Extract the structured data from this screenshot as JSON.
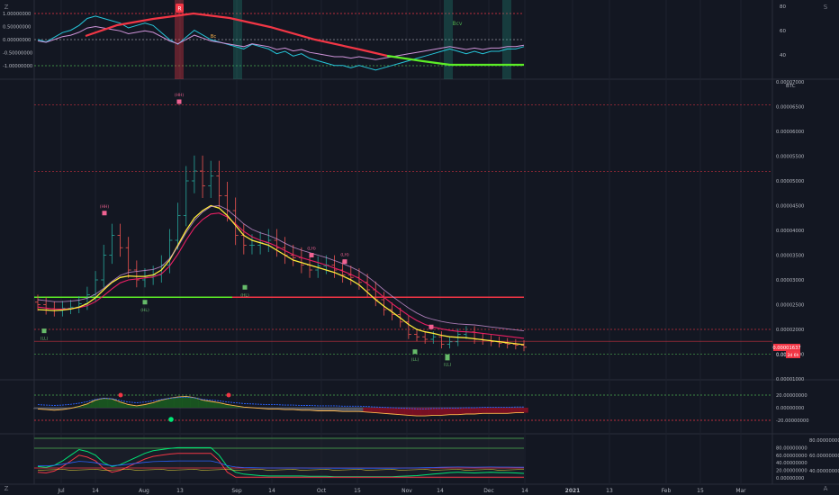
{
  "toolbar": {
    "left_button": "Z",
    "right_button": "S",
    "bottom_right_button": "A"
  },
  "panes": {
    "top": {
      "left_ticks": [
        "1.00000000",
        "0.50000000",
        "0.00000000",
        "-0.50000000",
        "-1.00000000"
      ],
      "left_tick_values": [
        1.0,
        0.5,
        0.0,
        -0.5,
        -1.0
      ],
      "right_ticks": [
        "80",
        "60",
        "40"
      ],
      "right_tick_values": [
        80,
        60,
        40
      ],
      "labels": {
        "r": "R",
        "bc": "Bc",
        "bcv": "Bcv"
      },
      "colors": {
        "red": "#f23645",
        "green": "#22ab94",
        "teal": "#26c6da",
        "pink": "#e040fb"
      }
    },
    "main": {
      "currency": "BTC",
      "price_ticks": [
        "0.00007000",
        "0.00006500",
        "0.00006000",
        "0.00005500",
        "0.00005000",
        "0.00004500",
        "0.00004000",
        "0.00003500",
        "0.00003000",
        "0.00002500",
        "0.00002000",
        "0.00001500",
        "0.00001000"
      ],
      "price_tick_values": [
        7e-05,
        6.5e-05,
        6e-05,
        5.5e-05,
        5e-05,
        4.5e-05,
        4e-05,
        3.5e-05,
        3e-05,
        2.5e-05,
        2e-05,
        1.5e-05,
        1e-05
      ],
      "last_price_label": "0.00001637",
      "last_price": 1.637e-05,
      "countdown_label_prefix": "0.000",
      "countdown_label": "2d 6h",
      "pivot_labels": [
        "(HH)",
        "(HH)",
        "(LL)",
        "(HL)",
        "(LH)",
        "(LH)",
        "(LL)",
        "(HL)",
        "(LL)",
        "(LL)",
        "(LL)"
      ],
      "level_lines": [
        6.54e-05,
        5.19e-05,
        2e-05,
        1.76e-05,
        1.5e-05
      ],
      "ma_colors": {
        "fast": "#ffeb3b",
        "slow": "#e91e63",
        "band": "#f23645"
      }
    },
    "osc1": {
      "ticks": [
        "20.00000000",
        "0.00000000",
        "-20.00000000"
      ],
      "tick_values": [
        20,
        0,
        -20
      ]
    },
    "osc2": {
      "left_ticks": [
        "80.00000000",
        "60.00000000",
        "40.00000000",
        "20.00000000",
        "0.00000000"
      ],
      "left_tick_values": [
        80,
        60,
        40,
        20,
        0
      ],
      "right_ticks": [
        "80.00000000",
        "60.00000000",
        "40.00000000"
      ],
      "right_tick_values": [
        80,
        60,
        40
      ]
    }
  },
  "time_axis": {
    "labels": [
      "Jul",
      "14",
      "Aug",
      "13",
      "Sep",
      "14",
      "Oct",
      "15",
      "Nov",
      "14",
      "Dec",
      "14",
      "2021",
      "13",
      "Feb",
      "15",
      "Mar"
    ],
    "bold": [
      "2021"
    ]
  },
  "chart_data": {
    "type": "candlestick",
    "x": [
      "Jun 21",
      "Jun 24",
      "Jun 27",
      "Jun 30",
      "Jul 3",
      "Jul 6",
      "Jul 9",
      "Jul 12",
      "Jul 15",
      "Jul 18",
      "Jul 21",
      "Jul 24",
      "Jul 27",
      "Jul 30",
      "Aug 2",
      "Aug 5",
      "Aug 8",
      "Aug 11",
      "Aug 14",
      "Aug 17",
      "Aug 20",
      "Aug 23",
      "Aug 26",
      "Aug 29",
      "Sep 1",
      "Sep 4",
      "Sep 7",
      "Sep 10",
      "Sep 13",
      "Sep 16",
      "Sep 19",
      "Sep 22",
      "Sep 25",
      "Sep 28",
      "Oct 1",
      "Oct 4",
      "Oct 7",
      "Oct 10",
      "Oct 13",
      "Oct 16",
      "Oct 19",
      "Oct 22",
      "Oct 25",
      "Oct 28",
      "Oct 31",
      "Nov 3",
      "Nov 6",
      "Nov 9",
      "Nov 12",
      "Nov 15",
      "Nov 18",
      "Nov 21",
      "Nov 24",
      "Nov 27",
      "Nov 30",
      "Dec 3",
      "Dec 6",
      "Dec 9",
      "Dec 12",
      "Dec 15"
    ],
    "close_e8": [
      2500,
      2420,
      2380,
      2430,
      2450,
      2520,
      2700,
      3000,
      3500,
      3900,
      3650,
      3200,
      3000,
      3050,
      3100,
      3300,
      3800,
      4300,
      5000,
      5200,
      4900,
      5100,
      4700,
      4400,
      3900,
      3700,
      3700,
      3750,
      3800,
      3650,
      3500,
      3450,
      3300,
      3200,
      3280,
      3300,
      3200,
      3100,
      3050,
      2950,
      2800,
      2600,
      2400,
      2300,
      2150,
      1900,
      1850,
      1800,
      1850,
      1700,
      1750,
      1900,
      1950,
      1800,
      1780,
      1750,
      1720,
      1700,
      1680,
      1640
    ],
    "ma_fast_e8": [
      2400,
      2390,
      2380,
      2390,
      2410,
      2450,
      2520,
      2640,
      2800,
      2950,
      3050,
      3080,
      3070,
      3070,
      3100,
      3200,
      3400,
      3700,
      4000,
      4250,
      4400,
      4500,
      4450,
      4300,
      4100,
      3900,
      3800,
      3750,
      3700,
      3600,
      3500,
      3400,
      3350,
      3300,
      3250,
      3200,
      3150,
      3080,
      3000,
      2900,
      2750,
      2600,
      2470,
      2350,
      2230,
      2100,
      2000,
      1950,
      1920,
      1880,
      1850,
      1840,
      1830,
      1810,
      1790,
      1770,
      1750,
      1730,
      1710,
      1690
    ],
    "ma_slow_e8": [
      2450,
      2430,
      2410,
      2410,
      2420,
      2440,
      2480,
      2560,
      2680,
      2820,
      2940,
      3000,
      3020,
      3040,
      3060,
      3120,
      3280,
      3520,
      3800,
      4050,
      4220,
      4330,
      4350,
      4270,
      4130,
      3980,
      3870,
      3800,
      3750,
      3680,
      3590,
      3510,
      3450,
      3400,
      3350,
      3300,
      3240,
      3180,
      3110,
      3030,
      2920,
      2790,
      2650,
      2520,
      2400,
      2280,
      2180,
      2100,
      2050,
      2010,
      1980,
      1960,
      1950,
      1940,
      1920,
      1900,
      1880,
      1860,
      1840,
      1820
    ],
    "osc1_values": [
      -2,
      -3,
      -4,
      -3,
      -1,
      2,
      6,
      12,
      15,
      14,
      9,
      5,
      3,
      5,
      8,
      12,
      15,
      17,
      18,
      16,
      12,
      10,
      8,
      5,
      3,
      1,
      0,
      -1,
      -2,
      -2,
      -3,
      -3,
      -4,
      -4,
      -5,
      -5,
      -5,
      -6,
      -6,
      -6,
      -7,
      -8,
      -9,
      -10,
      -11,
      -12,
      -13,
      -13,
      -12,
      -12,
      -11,
      -11,
      -10,
      -10,
      -9,
      -9,
      -9,
      -9,
      -8,
      -8
    ],
    "top_osc_values": [
      0.0,
      -0.1,
      0.1,
      0.3,
      0.4,
      0.6,
      0.9,
      1.0,
      0.9,
      0.8,
      0.7,
      0.5,
      0.6,
      0.7,
      0.6,
      0.3,
      0.0,
      -0.2,
      0.1,
      0.4,
      0.2,
      0.0,
      -0.1,
      -0.2,
      -0.3,
      -0.4,
      -0.2,
      -0.3,
      -0.4,
      -0.6,
      -0.5,
      -0.7,
      -0.6,
      -0.8,
      -0.9,
      -1.0,
      -1.1,
      -1.1,
      -1.2,
      -1.1,
      -1.2,
      -1.3,
      -1.2,
      -1.1,
      -1.0,
      -0.9,
      -0.8,
      -0.7,
      -0.6,
      -0.5,
      -0.4,
      -0.5,
      -0.6,
      -0.5,
      -0.6,
      -0.5,
      -0.5,
      -0.4,
      -0.4,
      -0.3
    ],
    "ylim": [
      1e-05,
      7e-05
    ]
  }
}
